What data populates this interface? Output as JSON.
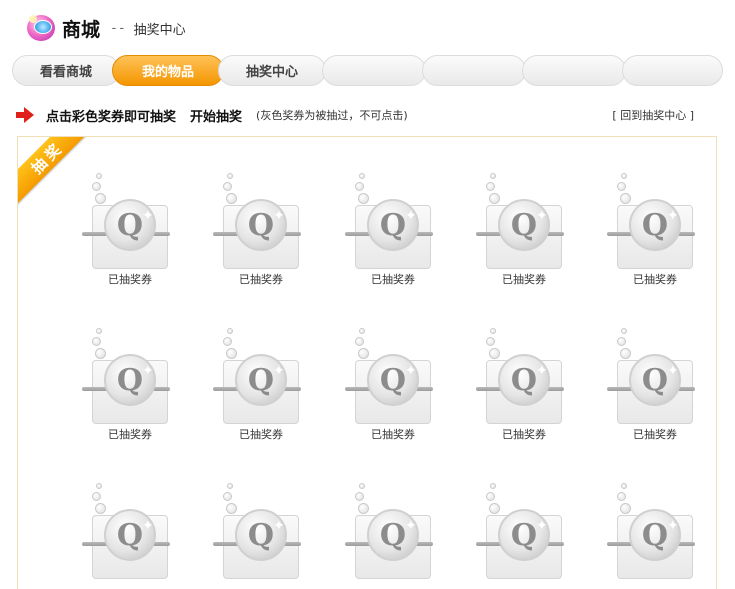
{
  "header": {
    "title": "商城",
    "separator": "--",
    "subtitle": "抽奖中心"
  },
  "tabs": [
    {
      "label": "看看商城",
      "active": false
    },
    {
      "label": "我的物品",
      "active": true
    },
    {
      "label": "抽奖中心",
      "active": false
    },
    {
      "label": "",
      "active": false
    },
    {
      "label": "",
      "active": false
    },
    {
      "label": "",
      "active": false
    }
  ],
  "instruction": {
    "main": "点击彩色奖券即可抽奖",
    "start": "开始抽奖",
    "note": "(灰色奖券为被抽过，不可点击)",
    "back_link": "[ 回到抽奖中心 ]"
  },
  "panel": {
    "ribbon_text": "抽奖"
  },
  "coupons": [
    {
      "label": "已抽奖券"
    },
    {
      "label": "已抽奖券"
    },
    {
      "label": "已抽奖券"
    },
    {
      "label": "已抽奖券"
    },
    {
      "label": "已抽奖券"
    },
    {
      "label": "已抽奖券"
    },
    {
      "label": "已抽奖券"
    },
    {
      "label": "已抽奖券"
    },
    {
      "label": "已抽奖券"
    },
    {
      "label": "已抽奖券"
    },
    {
      "label": ""
    },
    {
      "label": ""
    },
    {
      "label": ""
    },
    {
      "label": ""
    },
    {
      "label": ""
    }
  ],
  "colors": {
    "accent": "#f49600",
    "arrow": "#e0201a",
    "panel_border": "#f0e0b8"
  }
}
